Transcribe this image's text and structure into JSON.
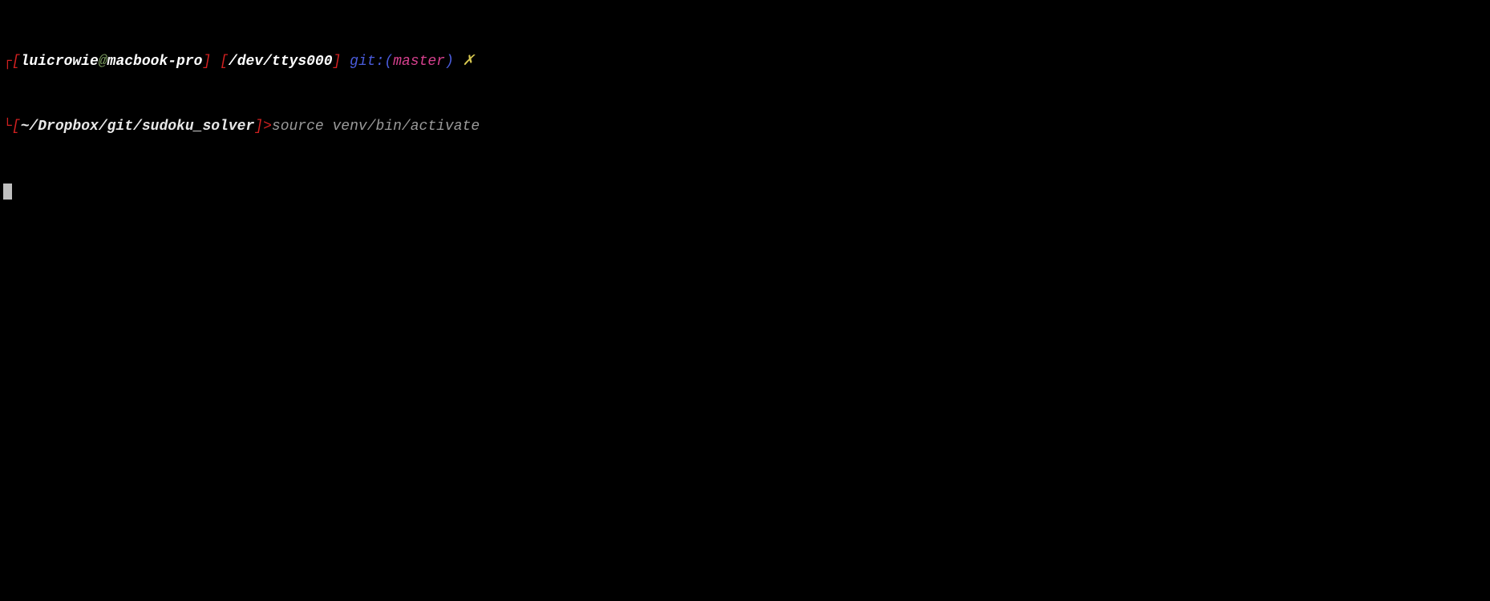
{
  "line1": {
    "bracket_open_1": "┌[",
    "user": "luicrowie",
    "at": "@",
    "host": "macbook-pro",
    "bracket_close_1": "]",
    "space1": " ",
    "bracket_open_2": "[",
    "tty": "/dev/ttys000",
    "bracket_close_2": "]",
    "space2": " ",
    "git_label": "git:(",
    "branch": "master",
    "git_close": ")",
    "space3": " ",
    "dirty": "✗"
  },
  "line2": {
    "bracket_open": "└[",
    "cwd": "~/Dropbox/git/sudoku_solver",
    "bracket_close": "]",
    "prompt_arrow": ">",
    "command": "source venv/bin/activate"
  }
}
